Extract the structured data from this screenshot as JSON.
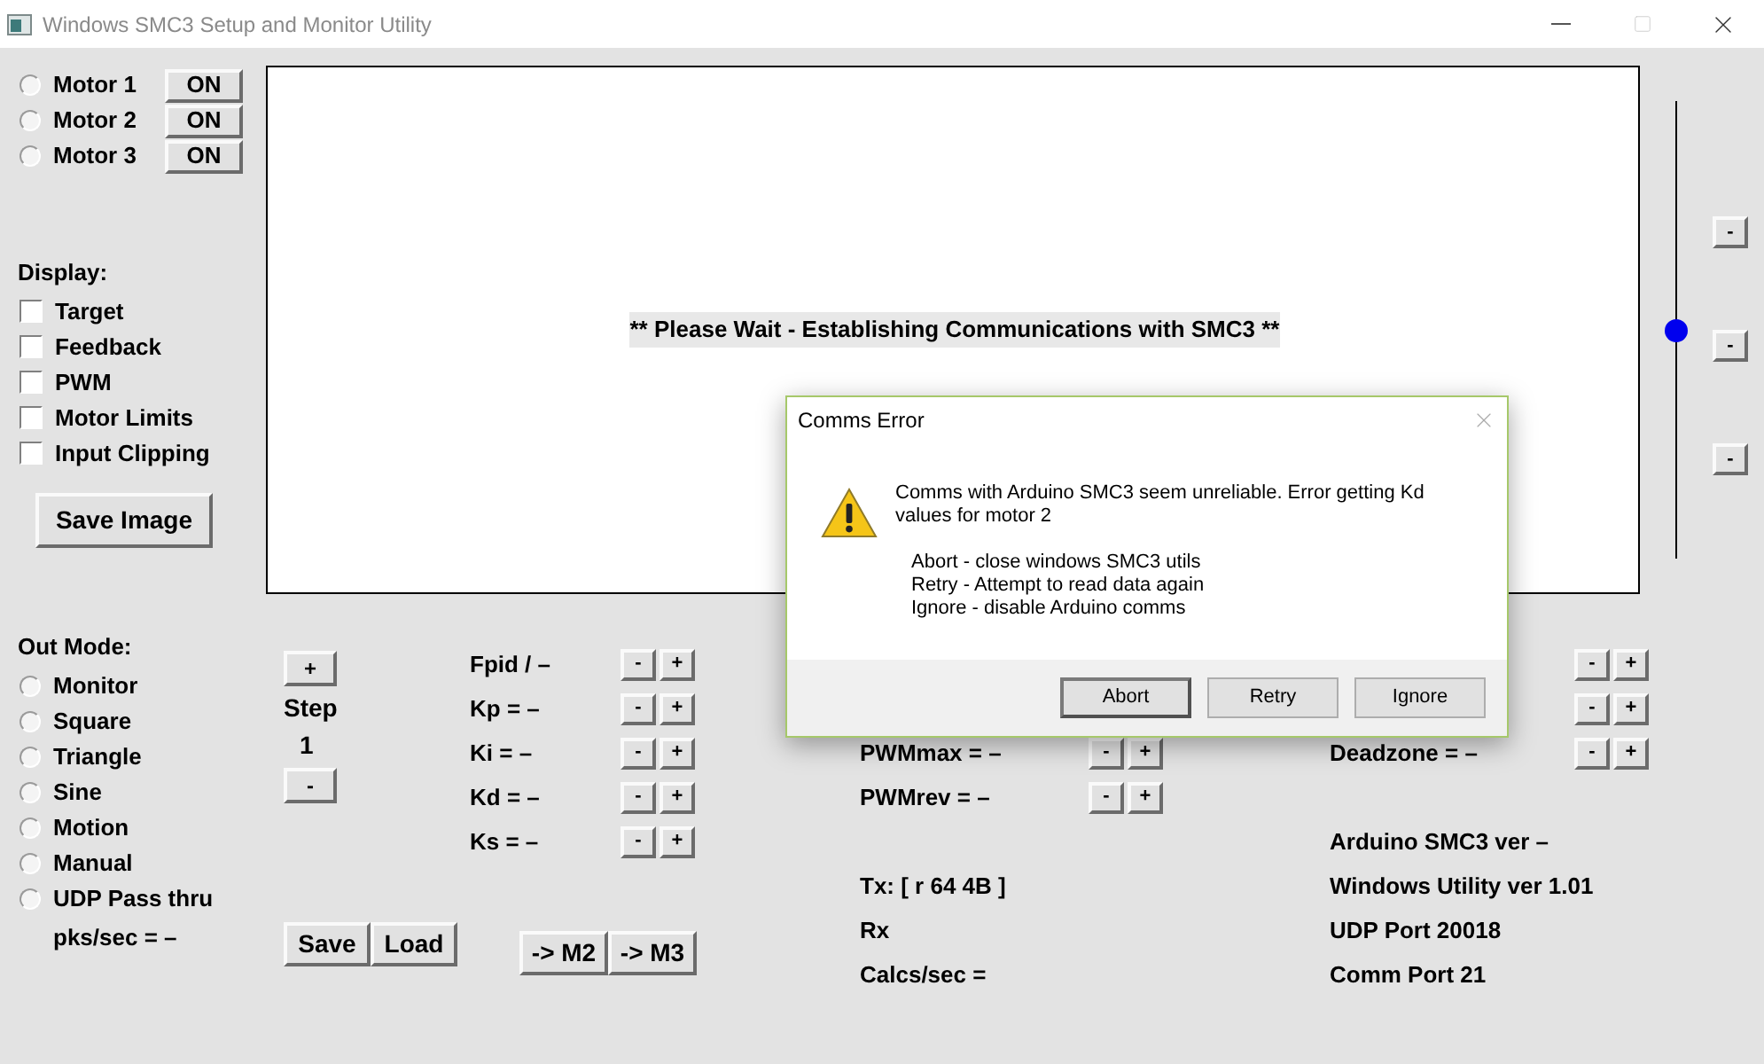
{
  "window": {
    "title": "Windows SMC3 Setup and Monitor Utility"
  },
  "motors": [
    {
      "label": "Motor 1",
      "selected": false,
      "button": "ON"
    },
    {
      "label": "Motor 2",
      "selected": false,
      "button": "ON"
    },
    {
      "label": "Motor 3",
      "selected": false,
      "button": "ON"
    }
  ],
  "display": {
    "heading": "Display:",
    "options": [
      {
        "label": "Target",
        "checked": false
      },
      {
        "label": "Feedback",
        "checked": false
      },
      {
        "label": "PWM",
        "checked": false
      },
      {
        "label": "Motor Limits",
        "checked": false
      },
      {
        "label": "Input Clipping",
        "checked": false
      }
    ]
  },
  "save_image_button": "Save Image",
  "graph": {
    "message": "** Please Wait - Establishing Communications with SMC3 **"
  },
  "scale_slider": {
    "level": 0.5,
    "buttons": [
      "-",
      "-",
      "-"
    ]
  },
  "out_mode": {
    "heading": "Out Mode:",
    "options": [
      {
        "label": "Monitor",
        "selected": false
      },
      {
        "label": "Square",
        "selected": false
      },
      {
        "label": "Triangle",
        "selected": false
      },
      {
        "label": "Sine",
        "selected": false
      },
      {
        "label": "Motion",
        "selected": false
      },
      {
        "label": "Manual",
        "selected": false
      },
      {
        "label": "UDP Pass thru",
        "selected": false
      }
    ],
    "rate": "pks/sec = –"
  },
  "step": {
    "increment": "+",
    "label": "Step",
    "value": "1",
    "decrement": "-"
  },
  "file_buttons": [
    "Save",
    "Load"
  ],
  "copy_buttons": [
    "-> M2",
    "-> M3"
  ],
  "pid_params": [
    {
      "label": "Fpid / –",
      "minus": "-",
      "plus": "+"
    },
    {
      "label": "Kp = –",
      "minus": "-",
      "plus": "+"
    },
    {
      "label": "Ki = –",
      "minus": "-",
      "plus": "+"
    },
    {
      "label": "Kd = –",
      "minus": "-",
      "plus": "+"
    },
    {
      "label": "Ks = –",
      "minus": "-",
      "plus": "+"
    }
  ],
  "pwm_params": [
    {
      "label": "PWMmax = –",
      "minus": "-",
      "plus": "+"
    },
    {
      "label": "PWMrev = –",
      "minus": "-",
      "plus": "+"
    }
  ],
  "comms_status": [
    "Tx: [ r 64 4B ]",
    "Rx",
    "Calcs/sec ="
  ],
  "limit_params": [
    {
      "minus": "-",
      "plus": "+"
    },
    {
      "minus": "-",
      "plus": "+"
    },
    {
      "label": "Deadzone = –",
      "minus": "-",
      "plus": "+"
    }
  ],
  "info": [
    "Arduino SMC3 ver –",
    "Windows Utility ver 1.01",
    "UDP Port 20018",
    "Comm Port 21"
  ],
  "dialog": {
    "title": "Comms Error",
    "message": "Comms with Arduino SMC3 seem unreliable. Error getting Kd values for motor 2",
    "options": [
      "Abort - close windows SMC3 utils",
      "Retry - Attempt to read data again",
      "Ignore - disable Arduino comms"
    ],
    "buttons": [
      {
        "label": "Abort",
        "default": true
      },
      {
        "label": "Retry",
        "default": false
      },
      {
        "label": "Ignore",
        "default": false
      }
    ]
  }
}
